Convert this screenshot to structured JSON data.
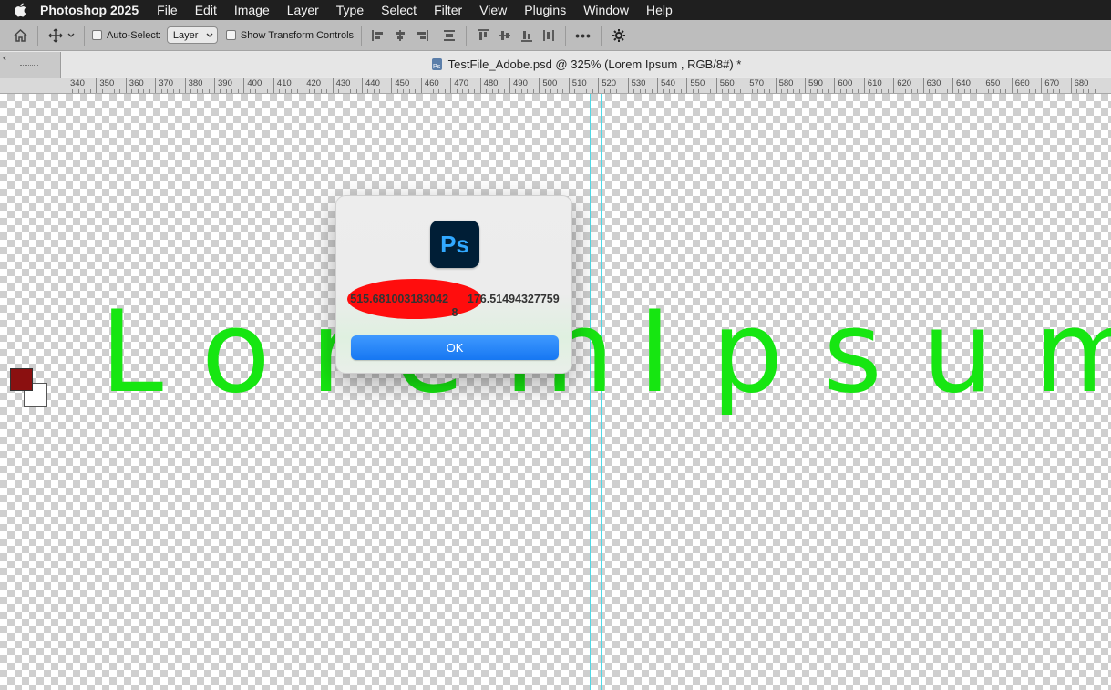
{
  "menubar": {
    "app_name": "Photoshop 2025",
    "items": [
      "File",
      "Edit",
      "Image",
      "Layer",
      "Type",
      "Select",
      "Filter",
      "View",
      "Plugins",
      "Window",
      "Help"
    ]
  },
  "options_bar": {
    "auto_select_label": "Auto-Select:",
    "auto_select_value": "Layer",
    "show_transform_label": "Show Transform Controls",
    "more_label": "•••"
  },
  "document": {
    "tab_title": "TestFile_Adobe.psd @ 325% (Lorem Ipsum , RGB/8#) *",
    "psd_icon_label": "Ps"
  },
  "ruler": {
    "labels": [
      "340",
      "350",
      "360",
      "370",
      "380",
      "390",
      "400",
      "410",
      "420",
      "430",
      "440",
      "450",
      "460",
      "470",
      "480",
      "490",
      "500",
      "510",
      "520",
      "530",
      "540",
      "550",
      "560",
      "570",
      "580",
      "590",
      "600",
      "610",
      "620",
      "630",
      "640",
      "650",
      "660",
      "670",
      "680"
    ]
  },
  "canvas": {
    "text_left": "Lorem",
    "text_right": "Ipsum",
    "text_color": "#16e611",
    "guide_color": "#4fd8e6"
  },
  "tools": {
    "foreground_color": "#8b1010",
    "background_color": "#ffffff",
    "more_tools_label": "•••"
  },
  "dialog": {
    "app_logo_text": "Ps",
    "message": "515.681003183042___176.514943277598",
    "ok_label": "OK"
  }
}
